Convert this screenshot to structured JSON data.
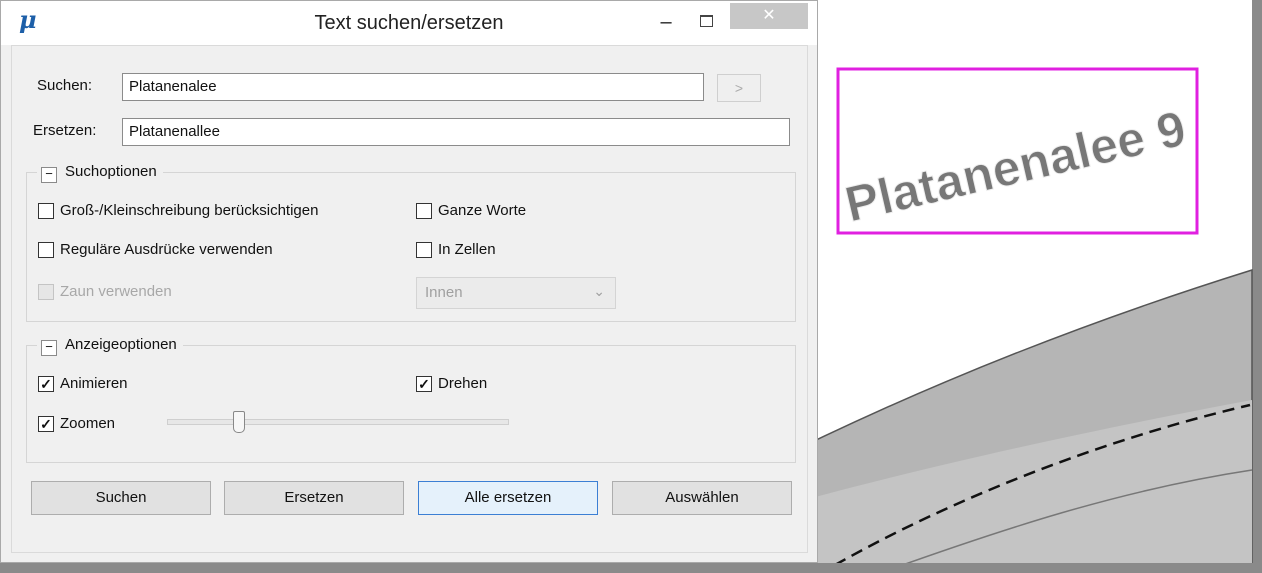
{
  "dialog": {
    "title": "Text suchen/ersetzen",
    "app_icon": "microstation-logo",
    "min_label": "–",
    "close_label": "✕"
  },
  "search": {
    "label": "Suchen:",
    "value": "Platanenalee",
    "next_label": ">"
  },
  "replace": {
    "label": "Ersetzen:",
    "value": "Platanenallee"
  },
  "search_options": {
    "title": "Suchoptionen",
    "toggle": "−",
    "case_sensitive": {
      "label": "Groß-/Kleinschreibung berücksichtigen",
      "checked": false
    },
    "whole_words": {
      "label": "Ganze Worte",
      "checked": false
    },
    "regex": {
      "label": "Reguläre Ausdrücke verwenden",
      "checked": false
    },
    "in_cells": {
      "label": "In Zellen",
      "checked": false
    },
    "use_fence": {
      "label": "Zaun verwenden",
      "checked": false,
      "enabled": false
    },
    "fence_mode": {
      "value": "Innen",
      "arrow": "⌄"
    }
  },
  "display_options": {
    "title": "Anzeigeoptionen",
    "toggle": "−",
    "animate": {
      "label": "Animieren",
      "checked": true
    },
    "rotate": {
      "label": "Drehen",
      "checked": true
    },
    "zoom": {
      "label": "Zoomen",
      "checked": true,
      "slider_value_fraction": 0.2
    }
  },
  "buttons": {
    "search": "Suchen",
    "replace": "Ersetzen",
    "replace_all": "Alle ersetzen",
    "select": "Auswählen"
  },
  "cad": {
    "text": "Platanenalee 9",
    "highlight_color": "#e020e0",
    "text_color": "#777777",
    "road_color": "#b8b8b8"
  }
}
